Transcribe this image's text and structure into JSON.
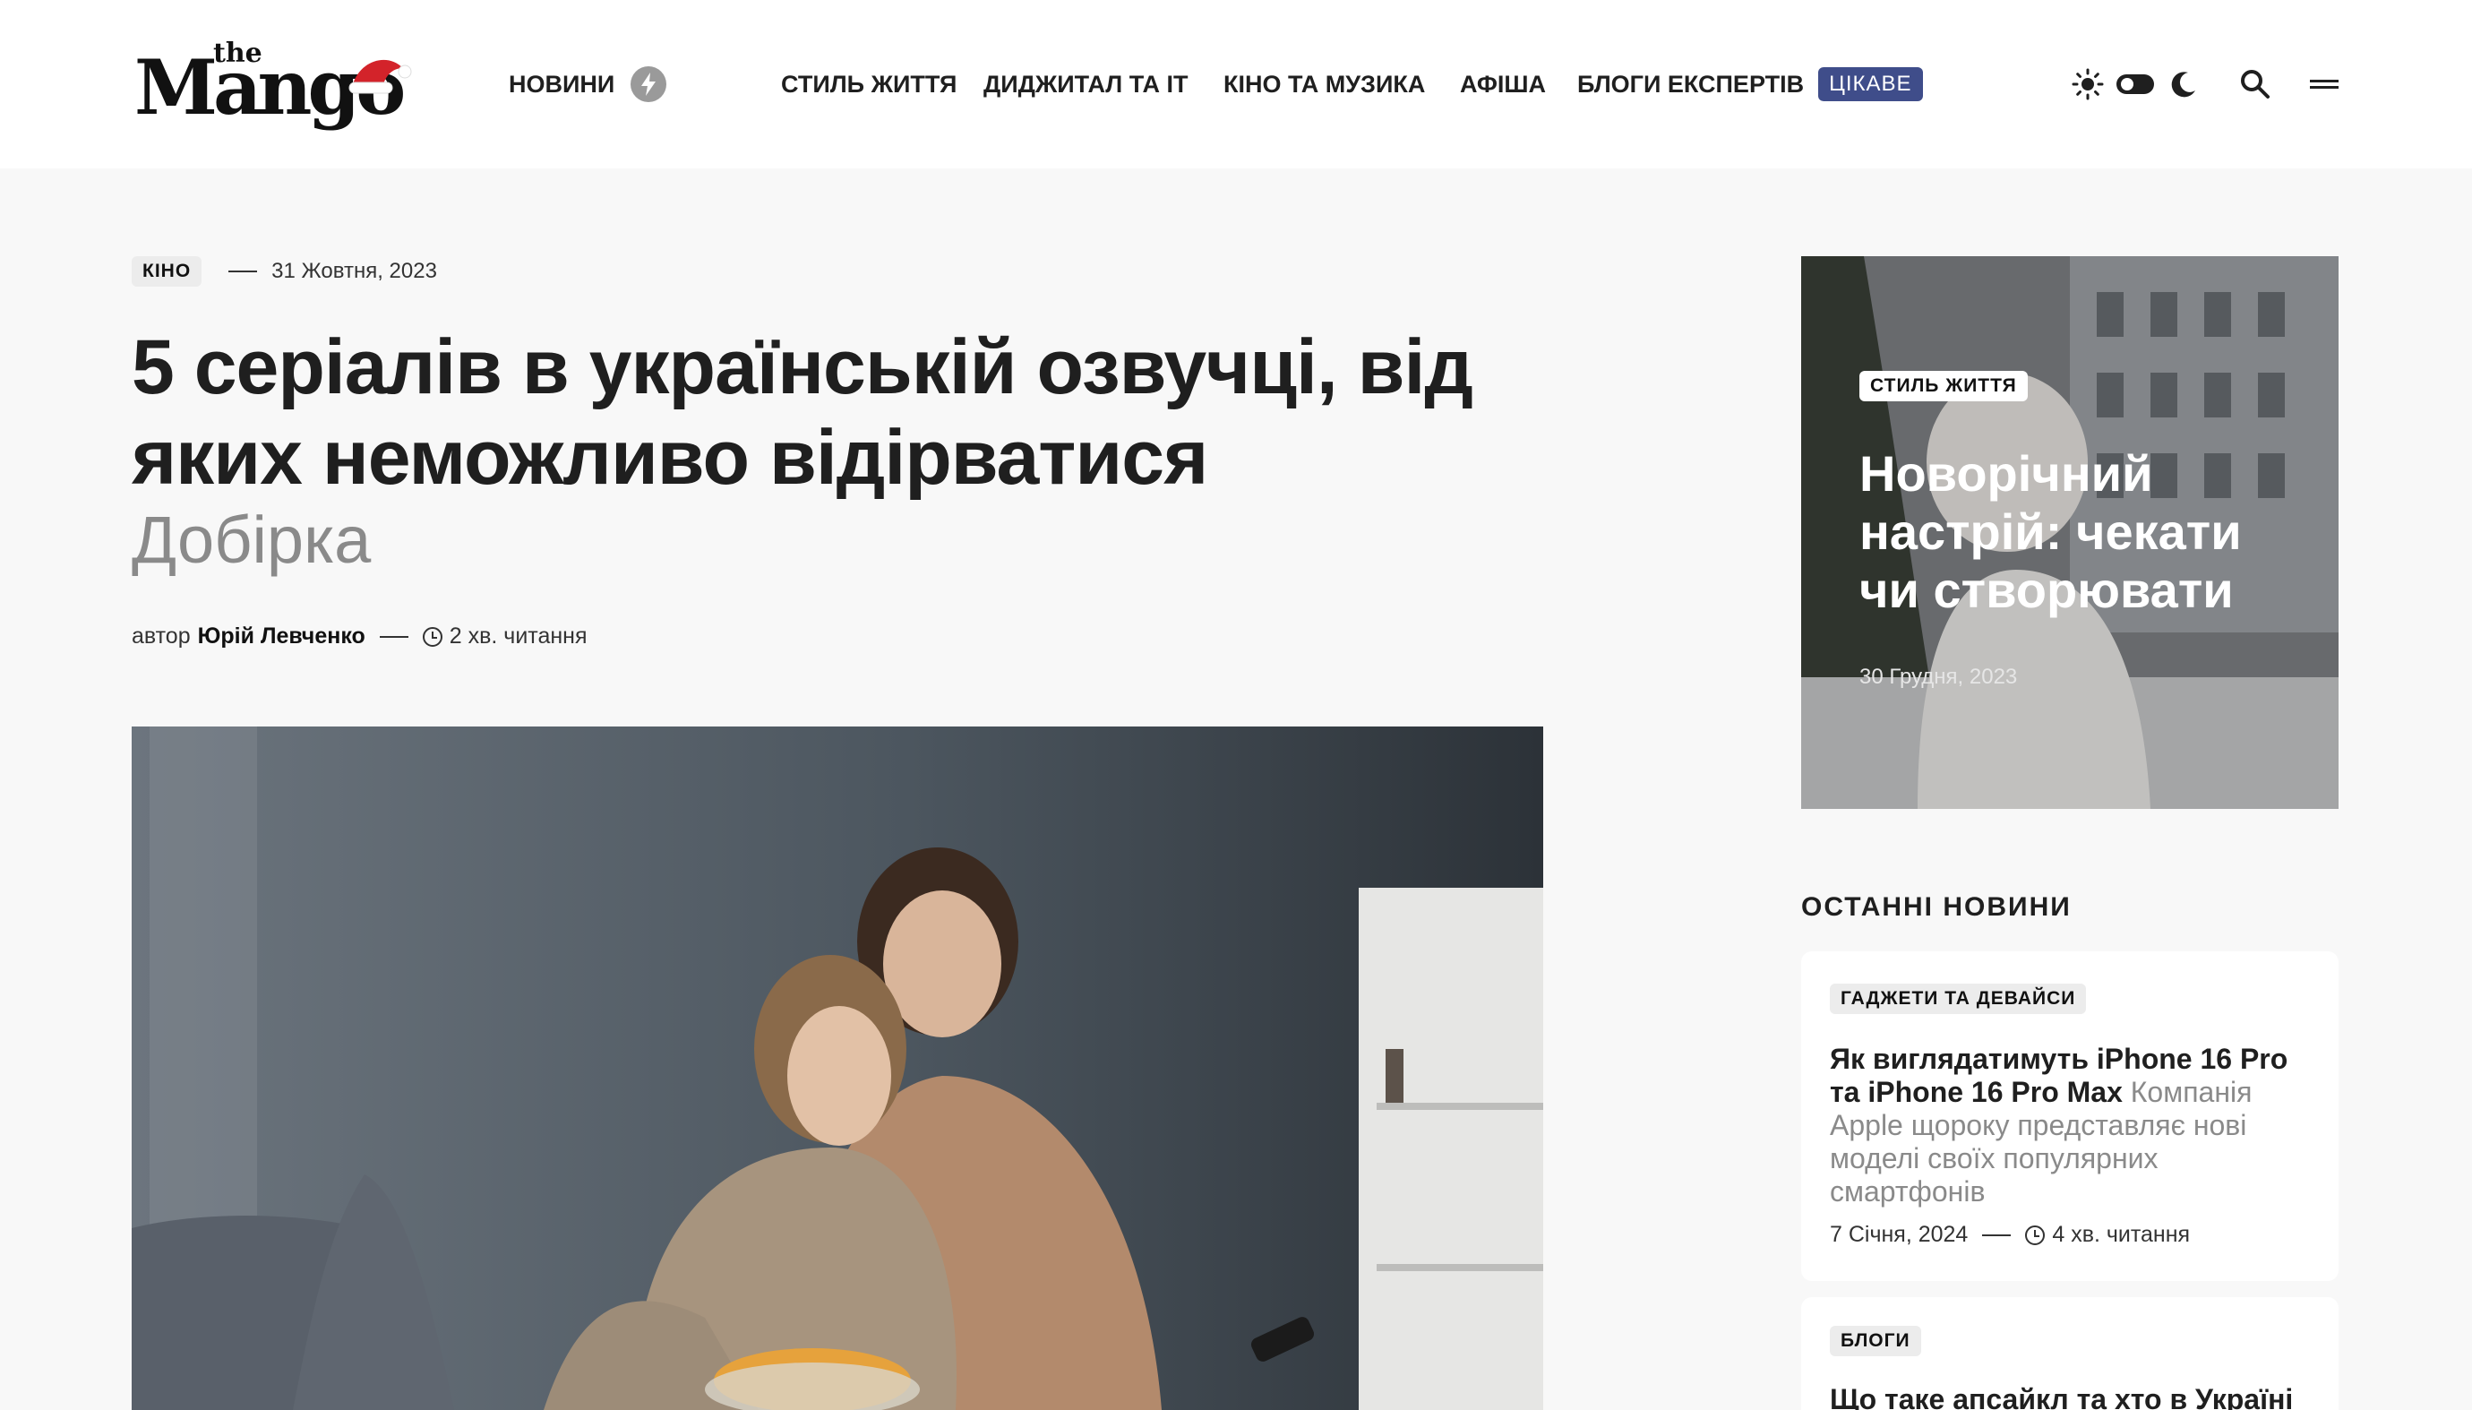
{
  "header": {
    "logo_the": "the",
    "logo_main": "Mango",
    "nav": [
      {
        "label": "НОВИНИ"
      },
      {
        "label": "СТИЛЬ ЖИТТЯ"
      },
      {
        "label": "ДИДЖИТАЛ ТА ІТ"
      },
      {
        "label": "КІНО ТА МУЗИКА"
      },
      {
        "label": "АФІША"
      },
      {
        "label": "БЛОГИ ЕКСПЕРТІВ"
      }
    ],
    "badge": "ЦІКАВЕ",
    "icons": [
      "lightning-icon",
      "sun-icon",
      "theme-toggle",
      "moon-icon",
      "search-icon",
      "menu-icon"
    ]
  },
  "article": {
    "category": "КІНО",
    "date": "31 Жовтня, 2023",
    "title": "5 серіалів в українській озвучці, від яких неможливо відірватися",
    "subtitle": "Добірка",
    "author_prefix": "автор",
    "author": "Юрій Левченко",
    "read_time": "2 хв. читання"
  },
  "sidebar": {
    "featured": {
      "category": "СТИЛЬ ЖИТТЯ",
      "title": "Новорічний настрій: чекати чи створювати",
      "date": "30 Грудня, 2023"
    },
    "latest_title": "ОСТАННІ НОВИНИ",
    "latest": [
      {
        "category": "ГАДЖЕТИ ТА ДЕВАЙСИ",
        "title": "Як виглядатимуть iPhone 16 Pro та iPhone 16 Pro Max",
        "excerpt": "Компанія Apple щороку представляє нові моделі своїх популярних смартфонів",
        "date": "7 Січня, 2024",
        "read_time": "4 хв. читання"
      },
      {
        "category": "БЛОГИ",
        "title": "Що таке апсайкл та хто в Україні",
        "excerpt": ""
      }
    ]
  },
  "colors": {
    "accent_badge": "#3f4d8a",
    "background": "#f8f8f8",
    "text": "#1f1f1f",
    "muted": "#8a8a8a"
  }
}
